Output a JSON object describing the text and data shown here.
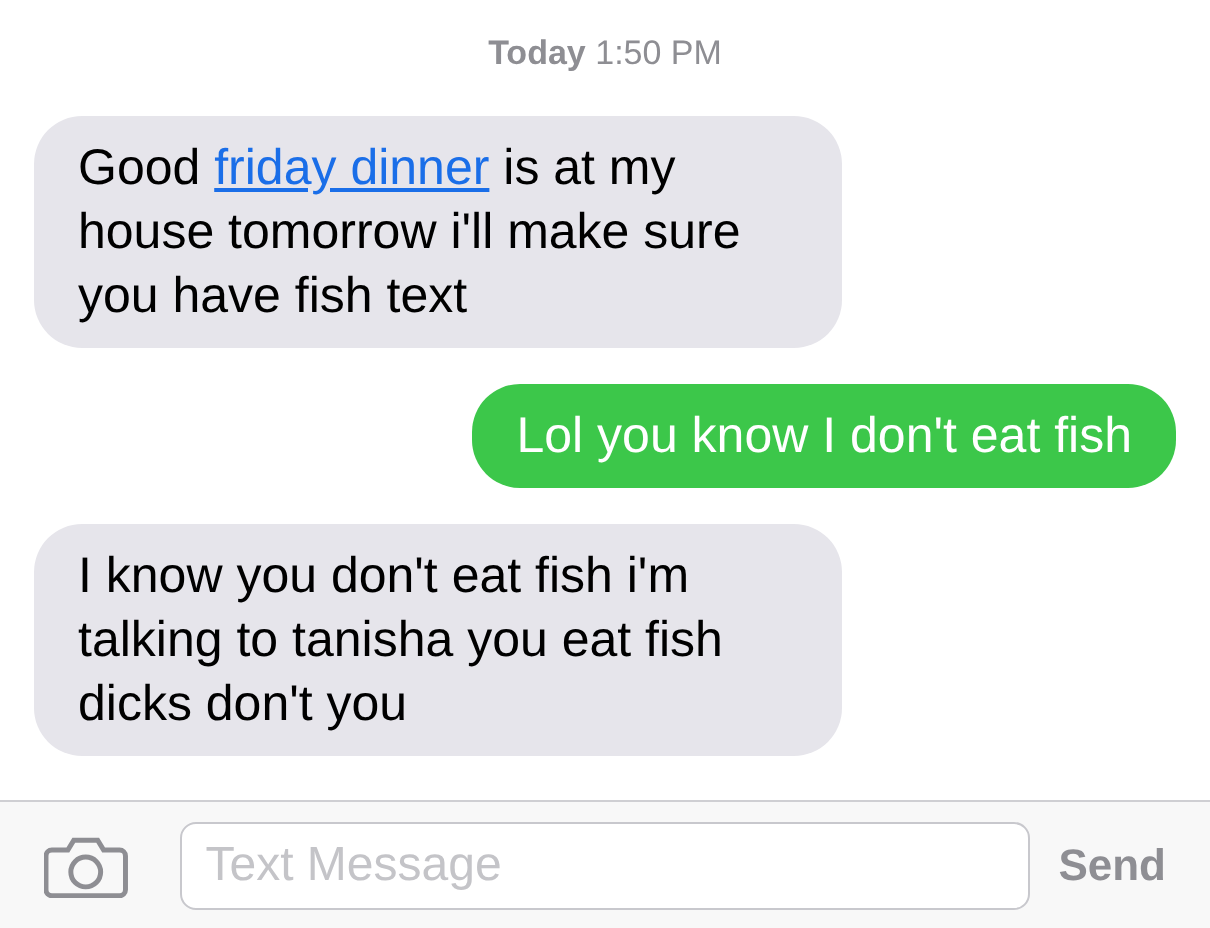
{
  "timestamp": {
    "day": "Today",
    "time": "1:50 PM"
  },
  "messages": [
    {
      "kind": "incoming",
      "parts": [
        {
          "kind": "text",
          "text": "Good "
        },
        {
          "kind": "link",
          "text": "friday dinner"
        },
        {
          "kind": "text",
          "text": " is at my house tomorrow i'll make sure you have fish text"
        }
      ]
    },
    {
      "kind": "outgoing",
      "parts": [
        {
          "kind": "text",
          "text": "Lol you know I don't eat fish"
        }
      ]
    },
    {
      "kind": "incoming",
      "parts": [
        {
          "kind": "text",
          "text": "I know you don't eat fish i'm talking to tanisha you eat fish dicks don't you"
        }
      ]
    }
  ],
  "composer": {
    "placeholder": "Text Message",
    "send": "Send"
  }
}
